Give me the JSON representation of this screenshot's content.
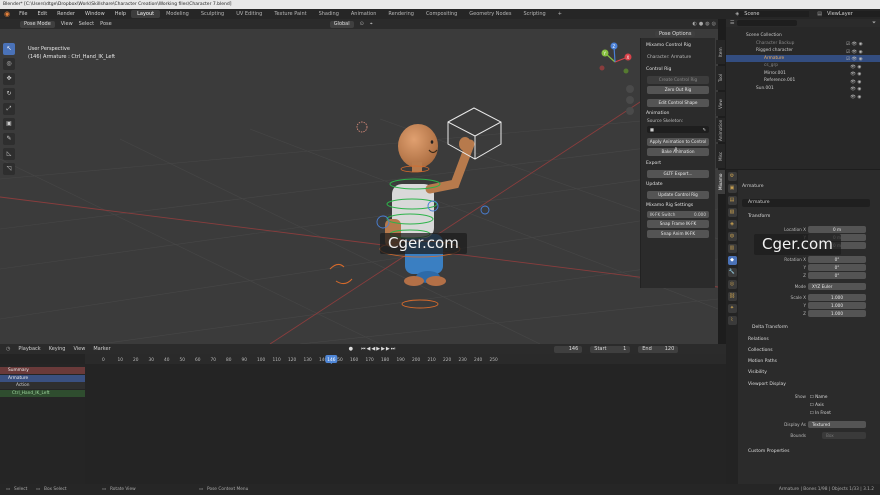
{
  "window_title": "Blender* [C:\\Users\\dtge\\Dropbox\\Work\\Skillshare\\Character Creation\\Working files\\Character 7.blend]",
  "menus": [
    "File",
    "Edit",
    "Render",
    "Window",
    "Help"
  ],
  "workspaces": [
    "Layout",
    "Modeling",
    "Sculpting",
    "UV Editing",
    "Texture Paint",
    "Shading",
    "Animation",
    "Rendering",
    "Compositing",
    "Geometry Nodes",
    "Scripting"
  ],
  "workspace_add": "+",
  "scene_label": "Scene",
  "viewlayer_label": "ViewLayer",
  "viewport": {
    "mode": "Pose Mode",
    "view": "View",
    "select": "Select",
    "pose": "Pose",
    "orientation": "Global",
    "pose_options": "Pose Options",
    "info_line1": "User Perspective",
    "info_line2": "(146) Armature : Ctrl_Hand_IK_Left",
    "gizmo_x": "X",
    "gizmo_y": "Y",
    "gizmo_z": "Z"
  },
  "tools": [
    "↖",
    "◎",
    "✥",
    "↻",
    "⤢",
    "▣",
    "✎",
    "◺",
    "◹"
  ],
  "npanel": {
    "title": "Mixamo Control Rig",
    "character": "Character: Armature",
    "control_rig_header": "Control Rig",
    "create_btn": "Create Control Rig",
    "zero_btn": "Zero Out Rig",
    "edit_shape_btn": "Edit Control Shape",
    "animation_header": "Animation",
    "source_label": "Source Skeleton:",
    "apply_btn": "Apply Animation to Control R...",
    "bake_btn": "Bake Animation",
    "export_header": "Export",
    "gltf_btn": "GLTF Export...",
    "update_header": "Update",
    "update_btn": "Update Control Rig",
    "settings_header": "Mixamo Rig Settings",
    "ikfk_label": "IK-FK Switch",
    "ikfk_value": "0.000",
    "snap_frame_btn": "Snap Frame IK-FK",
    "snap_anim_btn": "Snap Anim IK-FK"
  },
  "side_tabs": [
    "Item",
    "Tool",
    "View",
    "Animation",
    "Misc",
    "Mixamo"
  ],
  "timeline": {
    "playback": "Playback",
    "keying": "Keying",
    "view": "View",
    "marker": "Marker",
    "current": "146",
    "start_label": "Start",
    "start": "1",
    "end_label": "End",
    "end": "120",
    "frame_ticks": [
      "0",
      "10",
      "20",
      "30",
      "40",
      "50",
      "60",
      "70",
      "80",
      "90",
      "100",
      "110",
      "120",
      "130",
      "140",
      "146",
      "150",
      "160",
      "170",
      "180",
      "190",
      "200",
      "210",
      "220",
      "230",
      "240",
      "250"
    ],
    "channels": [
      "Summary",
      "Armature",
      "Action",
      "Ctrl_Hand_IK_Left"
    ]
  },
  "outliner": {
    "rows": [
      "Scene Collection",
      "Character Backup",
      "Rigged character",
      "Armature",
      "cs_grp",
      "Mirror.001",
      "Reference.001",
      "Sun.001"
    ]
  },
  "properties": {
    "object_name": "Armature",
    "data_name": "Armature",
    "transform_header": "Transform",
    "loc_x_label": "Location X",
    "loc_x": "0 m",
    "loc_y_label": "Y",
    "loc_y": "0 m",
    "loc_z_label": "Z",
    "loc_z": "0 m",
    "rot_x_label": "Rotation X",
    "rot_x": "0°",
    "rot_y_label": "Y",
    "rot_y": "0°",
    "rot_z_label": "Z",
    "rot_z": "0°",
    "mode_label": "Mode",
    "mode_value": "XYZ Euler",
    "scale_x_label": "Scale X",
    "scale_x": "1.000",
    "scale_y_label": "Y",
    "scale_y": "1.000",
    "scale_z_label": "Z",
    "scale_z": "1.000",
    "delta_header": "Delta Transform",
    "relations_header": "Relations",
    "collections_header": "Collections",
    "motion_header": "Motion Paths",
    "visibility_header": "Visibility",
    "viewport_display_header": "Viewport Display",
    "show_label": "Show",
    "name_opt": "Name",
    "axis_opt": "Axis",
    "infront_opt": "In Front",
    "display_as_label": "Display As",
    "display_as_value": "Textured",
    "bounds_label": "Bounds",
    "bounds_value": "Box",
    "custom_header": "Custom Properties"
  },
  "status": {
    "select": "Select",
    "box_select": "Box Select",
    "rotate": "Rotate View",
    "context": "Pose Context Menu",
    "right": "Armature | Bones 1/98 | Objects 1/33 | 3.1.2"
  },
  "watermark": "Cger.com",
  "colors": {
    "accent": "#4a72b8",
    "keyframe": "#e6b84a",
    "playhead": "#4f86d6"
  }
}
